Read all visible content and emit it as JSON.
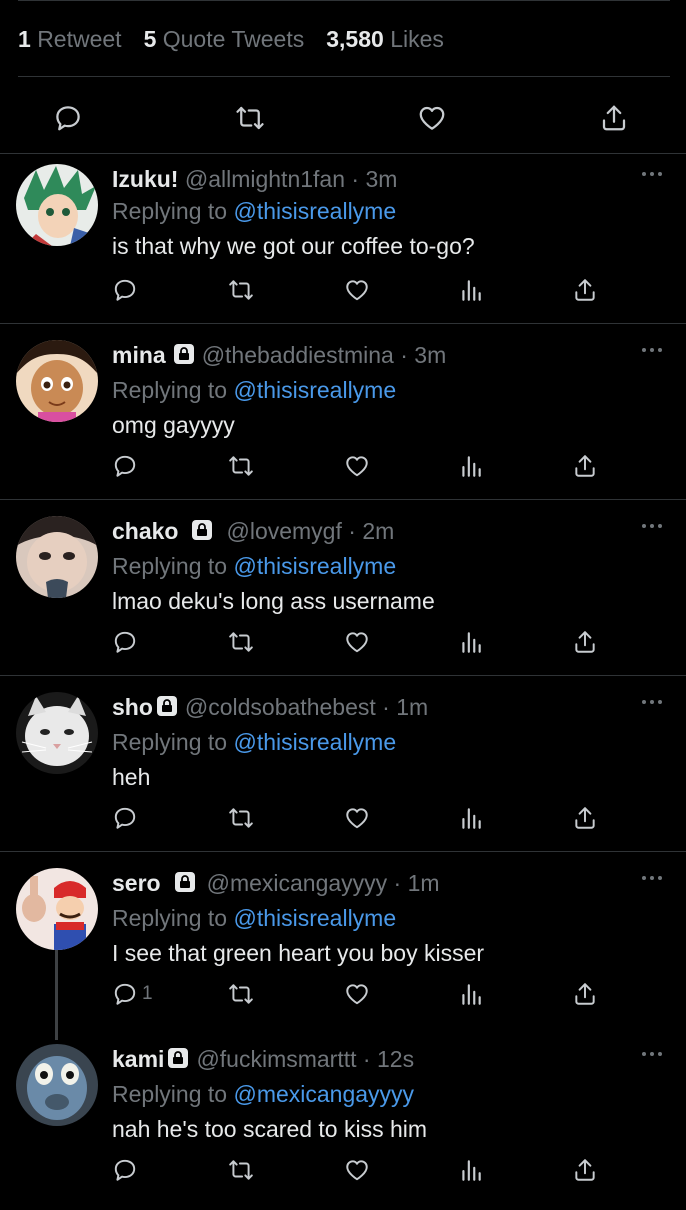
{
  "stats": {
    "retweets": {
      "num": "1",
      "label": "Retweet"
    },
    "quotes": {
      "num": "5",
      "label": "Quote Tweets"
    },
    "likes": {
      "num": "3,580",
      "label": "Likes"
    }
  },
  "icons": {
    "reply": "reply-icon",
    "retweet": "retweet-icon",
    "like": "heart-icon",
    "views": "analytics-icon",
    "share": "share-icon",
    "more": "more-icon",
    "lock": "lock-icon"
  },
  "colors": {
    "link": "#4a99e9",
    "muted": "#71767b",
    "text": "#e7e9ea",
    "bg": "#000000"
  },
  "replies": [
    {
      "name": "Izuku!",
      "locked": false,
      "handle": "@allmightn1fan",
      "time": "3m",
      "replying_prefix": "Replying to",
      "replying_to": "@thisisreallyme",
      "text": "is that why we got our coffee to-go?",
      "reply_count": ""
    },
    {
      "name": "mina",
      "locked": true,
      "handle": "@thebaddiestmina",
      "time": "3m",
      "replying_prefix": "Replying to",
      "replying_to": "@thisisreallyme",
      "text": "omg gayyyy",
      "reply_count": ""
    },
    {
      "name": "chako",
      "locked": true,
      "handle": "@lovemygf",
      "time": "2m",
      "replying_prefix": "Replying to",
      "replying_to": "@thisisreallyme",
      "text": "lmao deku's long ass username",
      "reply_count": ""
    },
    {
      "name": "sho",
      "locked": true,
      "handle": "@coldsobathebest",
      "time": "1m",
      "replying_prefix": "Replying to",
      "replying_to": "@thisisreallyme",
      "text": "heh",
      "reply_count": ""
    },
    {
      "name": "sero",
      "locked": true,
      "handle": "@mexicangayyyy",
      "time": "1m",
      "replying_prefix": "Replying to",
      "replying_to": "@thisisreallyme",
      "text": "I see that green heart you boy kisser",
      "reply_count": "1"
    },
    {
      "name": "kami",
      "locked": true,
      "handle": "@fuckimsmarttt",
      "time": "12s",
      "replying_prefix": "Replying to",
      "replying_to": "@mexicangayyyy",
      "text": "nah he's too scared to kiss him",
      "reply_count": ""
    }
  ]
}
